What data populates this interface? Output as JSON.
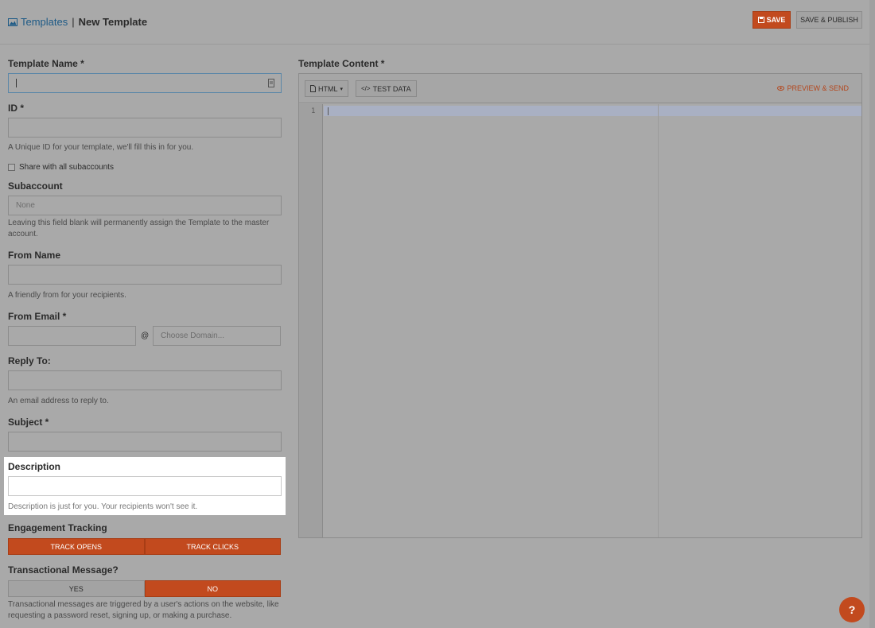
{
  "header": {
    "breadcrumb_root": "Templates",
    "breadcrumb_sep": "|",
    "breadcrumb_current": "New Template",
    "save_label": "SAVE",
    "save_publish_label": "SAVE & PUBLISH"
  },
  "form": {
    "template_name_label": "Template Name *",
    "template_name_value": "",
    "id_label": "ID *",
    "id_help": "A Unique ID for your template, we'll fill this in for you.",
    "share_label": "Share with all subaccounts",
    "subaccount_label": "Subaccount",
    "subaccount_placeholder": "None",
    "subaccount_help": "Leaving this field blank will permanently assign the Template to the master account.",
    "from_name_label": "From Name",
    "from_name_help": "A friendly from for your recipients.",
    "from_email_label": "From Email *",
    "at_symbol": "@",
    "domain_placeholder": "Choose Domain...",
    "reply_to_label": "Reply To:",
    "reply_to_help": "An email address to reply to.",
    "subject_label": "Subject *",
    "description_label": "Description",
    "description_help": "Description is just for you. Your recipients won't see it.",
    "engagement_label": "Engagement Tracking",
    "track_opens": "TRACK OPENS",
    "track_clicks": "TRACK CLICKS",
    "transactional_label": "Transactional Message?",
    "yes_label": "YES",
    "no_label": "NO",
    "transactional_help": "Transactional messages are triggered by a user's actions on the website, like requesting a password reset, signing up, or making a purchase."
  },
  "editor": {
    "content_label": "Template Content *",
    "html_label": "HTML",
    "test_data_label": "TEST DATA",
    "preview_label": "PREVIEW & SEND",
    "line_number": "1"
  },
  "help_button": "?",
  "colors": {
    "accent": "#c24a1e",
    "link": "#1d5a86",
    "overlay_bg": "#a9a9a9",
    "highlight_bg": "#ffffff"
  }
}
